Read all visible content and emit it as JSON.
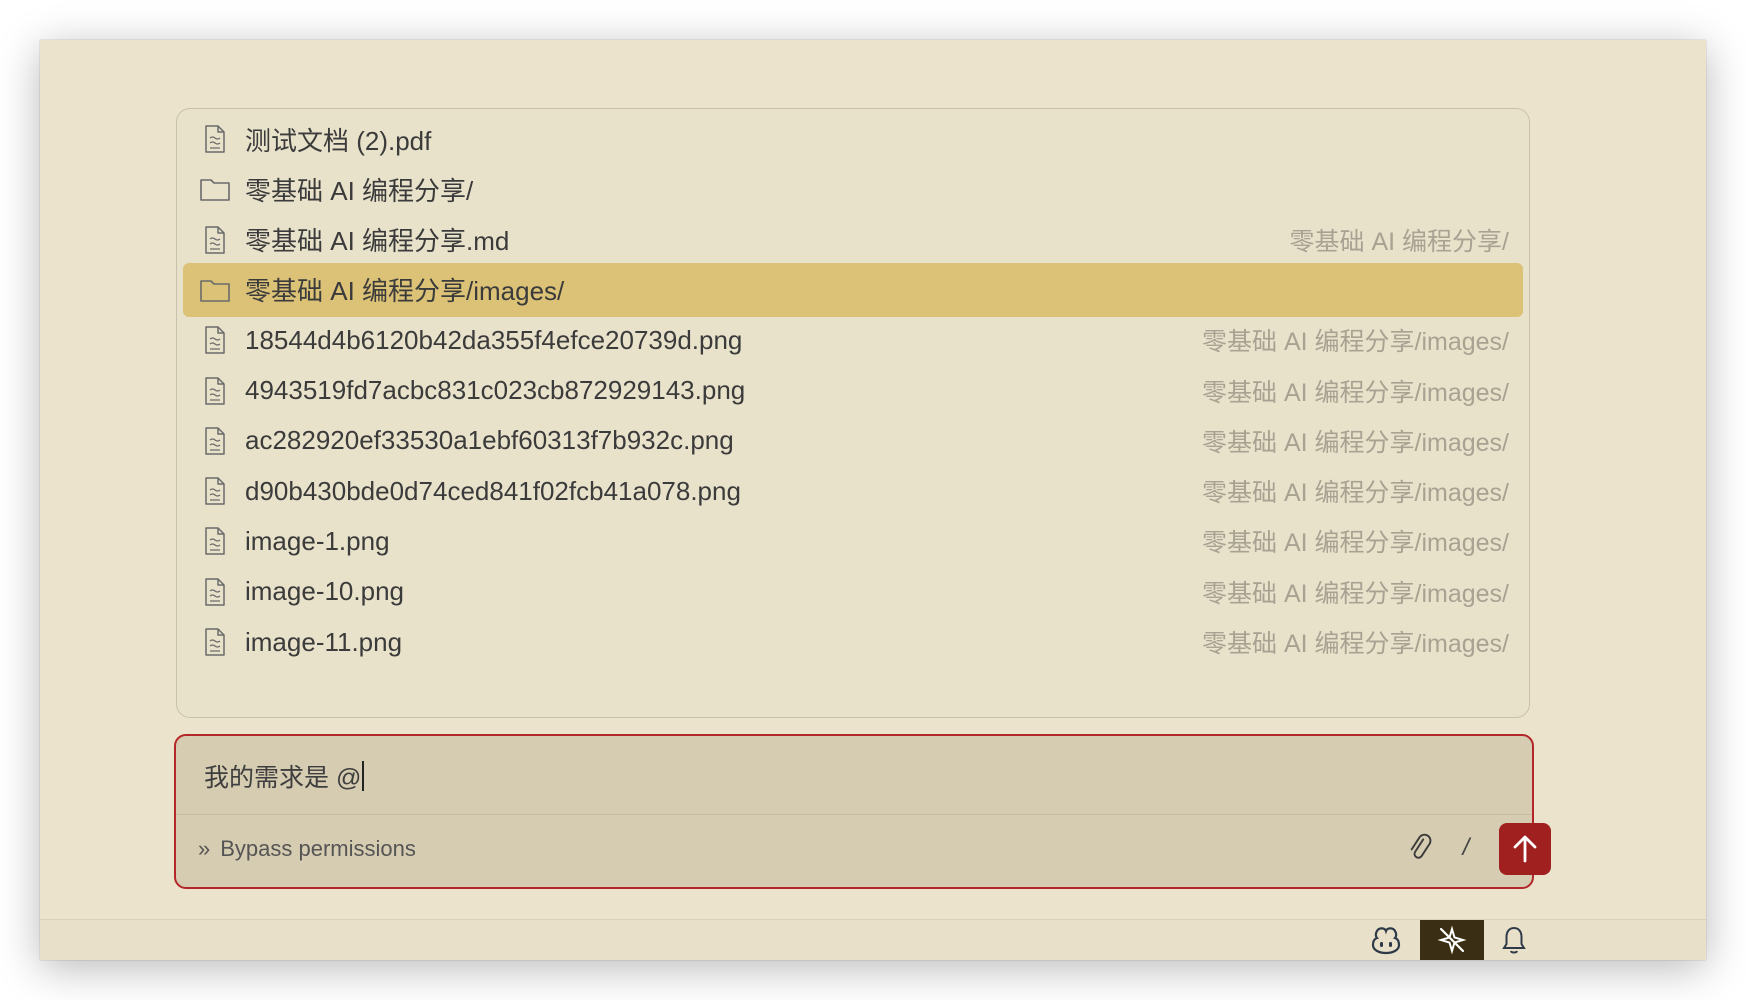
{
  "mention_popup": {
    "items": [
      {
        "type": "file",
        "name": "测试文档 (2).pdf",
        "path": ""
      },
      {
        "type": "folder",
        "name": "零基础 AI 编程分享/",
        "path": ""
      },
      {
        "type": "file",
        "name": "零基础 AI 编程分享.md",
        "path": "零基础 AI 编程分享/"
      },
      {
        "type": "folder",
        "name": "零基础 AI 编程分享/images/",
        "path": "",
        "selected": true
      },
      {
        "type": "file",
        "name": "18544d4b6120b42da355f4efce20739d.png",
        "path": "零基础 AI 编程分享/images/"
      },
      {
        "type": "file",
        "name": "4943519fd7acbc831c023cb872929143.png",
        "path": "零基础 AI 编程分享/images/"
      },
      {
        "type": "file",
        "name": "ac282920ef33530a1ebf60313f7b932c.png",
        "path": "零基础 AI 编程分享/images/"
      },
      {
        "type": "file",
        "name": "d90b430bde0d74ced841f02fcb41a078.png",
        "path": "零基础 AI 编程分享/images/"
      },
      {
        "type": "file",
        "name": "image-1.png",
        "path": "零基础 AI 编程分享/images/"
      },
      {
        "type": "file",
        "name": "image-10.png",
        "path": "零基础 AI 编程分享/images/"
      },
      {
        "type": "file",
        "name": "image-11.png",
        "path": "零基础 AI 编程分享/images/"
      }
    ]
  },
  "composer": {
    "input_value": "我的需求是 @",
    "mode_label": "Bypass permissions",
    "mode_icon": "double-chevron-right-icon",
    "attach_icon": "paperclip-icon",
    "slash_label": "/",
    "send_icon": "arrow-up-icon"
  },
  "statusbar": {
    "icons": [
      "copilot-icon",
      "sparkle-off-icon",
      "bell-icon"
    ]
  },
  "colors": {
    "background": "#ebe3cb",
    "selected_row": "#dbc277",
    "accent_red": "#a01f1f",
    "composer_border": "#b3262a"
  }
}
